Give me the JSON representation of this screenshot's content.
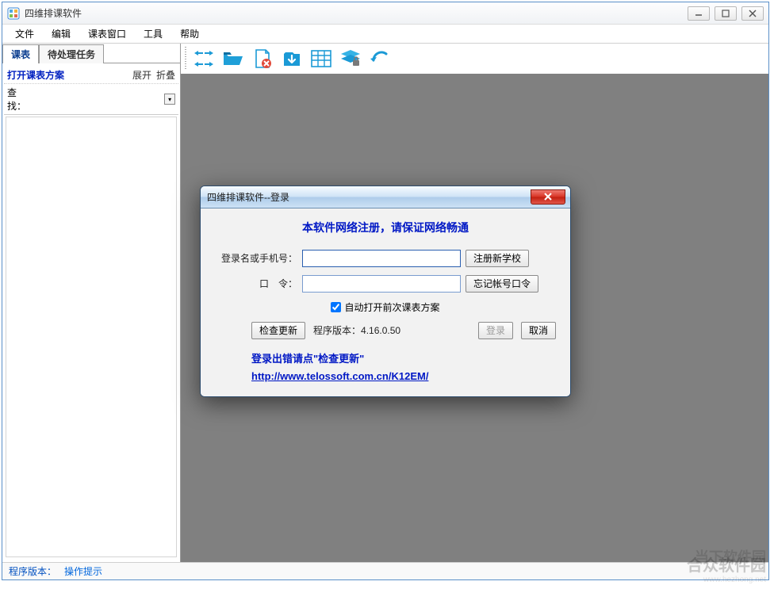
{
  "window": {
    "title": "四维排课软件"
  },
  "menu": {
    "file": "文件",
    "edit": "编辑",
    "schedule_window": "课表窗口",
    "tools": "工具",
    "help": "帮助"
  },
  "sidebar": {
    "tab_schedule": "课表",
    "tab_tasks": "待处理任务",
    "open_plan": "打开课表方案",
    "expand": "展开",
    "collapse": "折叠",
    "search_label": "查找："
  },
  "toolbar_icons": [
    "nav-arrows-icon",
    "open-folder-icon",
    "delete-file-icon",
    "download-icon",
    "table-grid-icon",
    "layers-lock-icon",
    "undo-icon"
  ],
  "status": {
    "version_label": "程序版本：",
    "hint": "操作提示"
  },
  "dialog": {
    "title": "四维排课软件--登录",
    "heading": "本软件网络注册，请保证网络畅通",
    "login_label": "登录名或手机号：",
    "password_label": "口　令：",
    "register_btn": "注册新学校",
    "forgot_btn": "忘记帐号口令",
    "auto_open_label": "自动打开前次课表方案",
    "auto_open_checked": true,
    "check_update_btn": "检查更新",
    "version_text": "程序版本：4.16.0.50",
    "login_btn": "登录",
    "cancel_btn": "取消",
    "error_hint": "登录出错请点\"检查更新\"",
    "url": "http://www.telossoft.com.cn/K12EM/"
  },
  "watermark": {
    "line1": "当下软件园",
    "line2": "合众软件园",
    "url": "www.hezhong.net"
  }
}
